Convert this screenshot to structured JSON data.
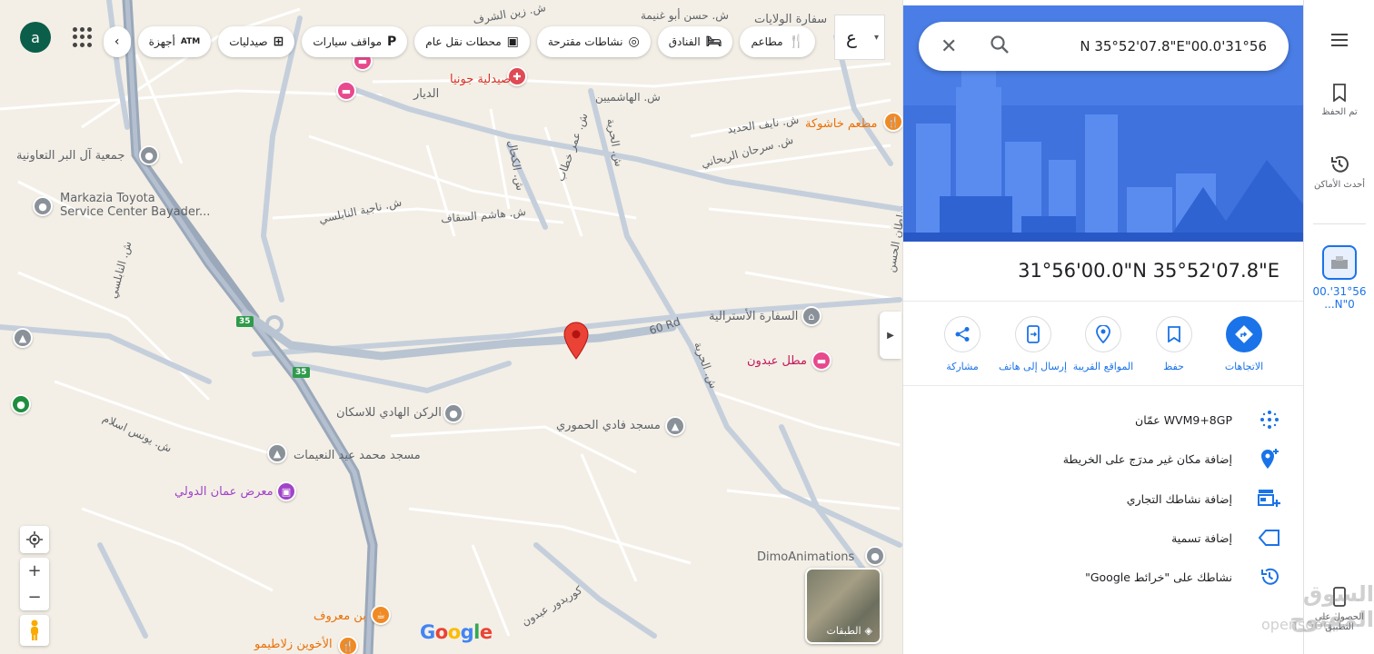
{
  "map": {
    "avatar_letter": "a",
    "lang_toggle": "ع",
    "chips": [
      {
        "icon": "restaurant-icon",
        "label": "مطاعم"
      },
      {
        "icon": "hotel-icon",
        "label": "الفنادق"
      },
      {
        "icon": "camera-icon",
        "label": "نشاطات مقترحة"
      },
      {
        "icon": "transit-icon",
        "label": "محطات نقل عام"
      },
      {
        "icon": "parking-icon",
        "label": "مواقف سيارات"
      },
      {
        "icon": "pharmacy-icon",
        "label": "صيدليات"
      },
      {
        "icon": "atm-icon",
        "label": "أجهزة"
      }
    ],
    "streets": {
      "hashmieen": "ش. الهاشميين",
      "diyar": "الديار",
      "hurriya": "ش. الحرية",
      "hurriya2": "ش. الحرية",
      "naif": "ش. نايف الحديد",
      "sarhan": "ش. سرحان الريحاني",
      "najia": "ش. ناجية النابلسي",
      "hashem": "ش. هاشم السقاف",
      "ring60": "60 Rd",
      "younis": "ش. يونس اسلام",
      "corridor": "كوريدور عبدون",
      "zain": "ش. زين الشرف",
      "hassan": "ش. حسن أبو غنيمة",
      "omar": "ش. عمر خطاب",
      "kahhal": "ش. الكحال",
      "nabulsi": "ش. النابلسي",
      "sultan": "ش. سلطان الحسن"
    },
    "pois": {
      "pharmacy": "صيدلية جونيا",
      "restaurant": "مطعم خاشوكة",
      "embassy_us": "سفارة الولايات",
      "coop": "جمعية آل البر التعاونية",
      "toyota_line1": "Markazia Toyota",
      "toyota_line2": "Service Center Bayader...",
      "australian": "السفارة الأسترالية",
      "abdoun_motel": "مطل عبدون",
      "rukn": "الركن الهادي للاسكان",
      "mosque_hamouri": "مسجد فادي الحموري",
      "mosque_nuaimat": "مسجد محمد عيد النعيمات",
      "expo": "معرض عمان الدولي",
      "dimo": "DimoAnimations",
      "maarouf": "بن معروف",
      "zalatimo": "الأخوين زلاطيمو"
    },
    "route_shields": [
      "35",
      "35"
    ],
    "layers_label": "الطبقات",
    "google_logo": "Google"
  },
  "panel": {
    "search_query": "N 35°52'07.8\"E\"00.0'31°56",
    "title": "31°56'00.0\"N 35°52'07.8\"E",
    "actions": [
      {
        "icon": "directions-icon",
        "label": "الاتجاهات",
        "primary": true
      },
      {
        "icon": "bookmark-icon",
        "label": "حفظ",
        "primary": false
      },
      {
        "icon": "nearby-icon",
        "label": "المواقع القريبة",
        "primary": false
      },
      {
        "icon": "send-to-phone-icon",
        "label": "إرسال إلى هاتف",
        "primary": false
      },
      {
        "icon": "share-icon",
        "label": "مشاركة",
        "primary": false
      }
    ],
    "rows": [
      {
        "icon": "plus-code-icon",
        "text": "WVM9+8GP عمّان"
      },
      {
        "icon": "add-place-icon",
        "text": "إضافة مكان غير مدرَج على الخريطة"
      },
      {
        "icon": "add-business-icon",
        "text": "إضافة نشاطك التجاري"
      },
      {
        "icon": "label-icon",
        "text": "إضافة تسمية"
      },
      {
        "icon": "history-icon",
        "text": "نشاطك على \"خرائط Google\""
      }
    ]
  },
  "rail": {
    "menu_icon": "menu-icon",
    "saved": "تم الحفظ",
    "recent": "أحدث الأماكن",
    "recent_item": "31°56'00.0\"N...",
    "get_app": "الحصول على التطبيق"
  },
  "watermark": {
    "text": "السوق المفتوح",
    "sub": "opensooq"
  },
  "colors": {
    "accent": "#1a73e8",
    "pin": "#ea4335",
    "hero": "#3b6fe0"
  }
}
